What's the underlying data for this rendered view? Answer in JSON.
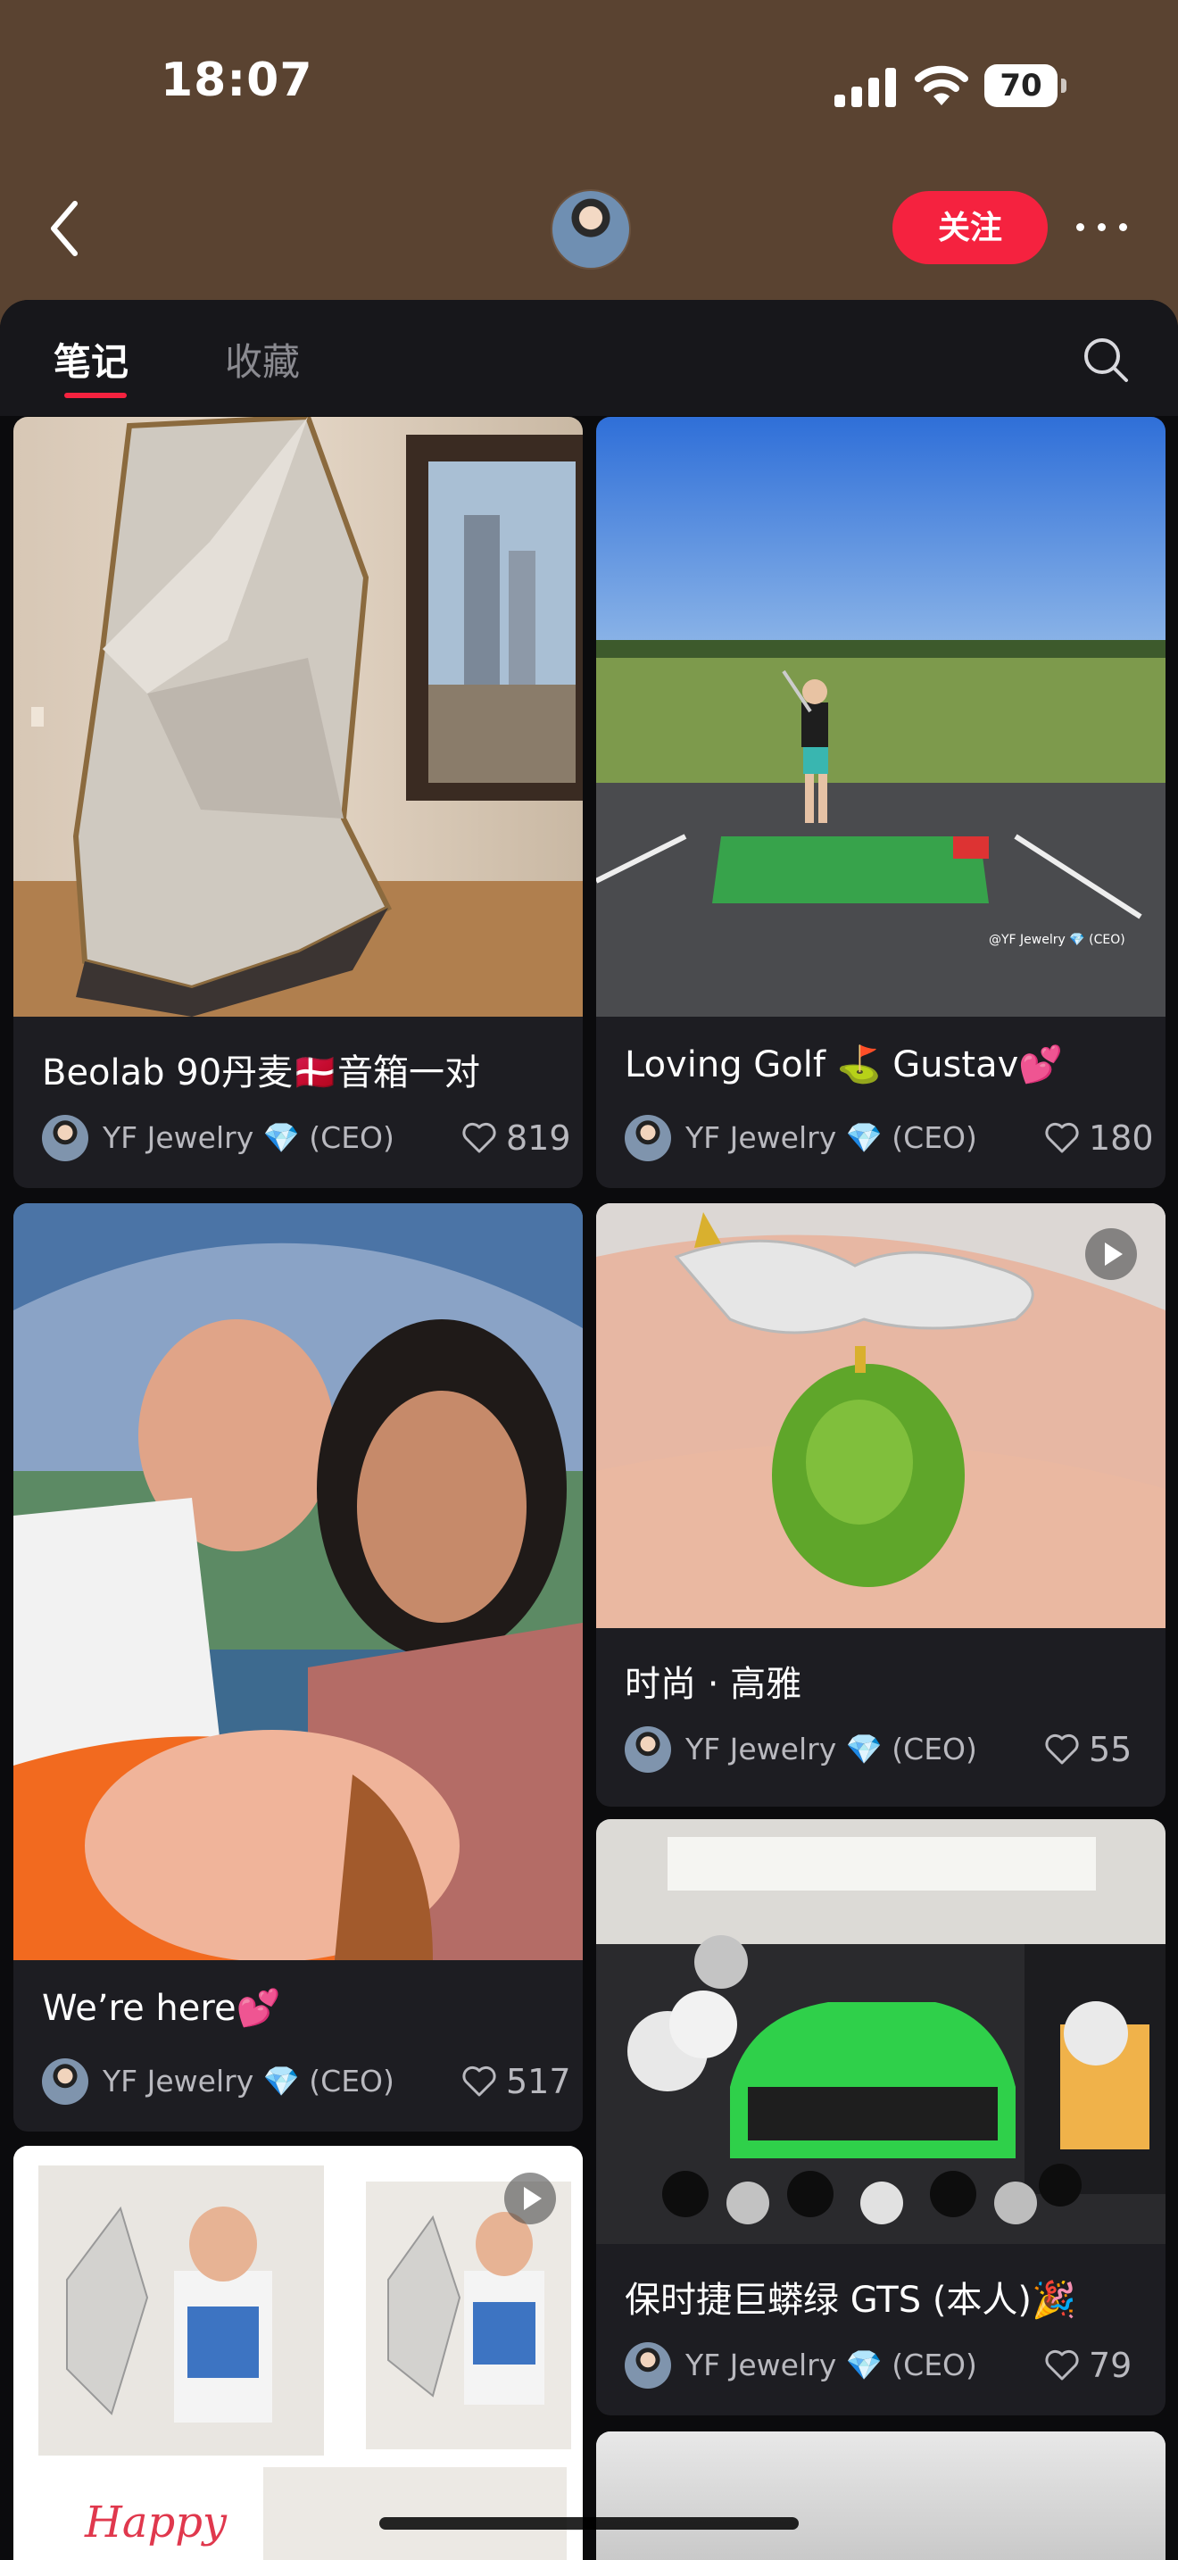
{
  "status_bar": {
    "time": "18:07",
    "battery": "70"
  },
  "header": {
    "follow_label": "关注"
  },
  "tabs": {
    "notes": "笔记",
    "collections": "收藏"
  },
  "cards": [
    {
      "title": "Beolab 90丹麦🇩🇰音箱一对",
      "author": "YF Jewelry 💎 (CEO)",
      "likes": "819"
    },
    {
      "title": "Loving Golf ⛳ Gustav💕",
      "author": "YF Jewelry 💎 (CEO)",
      "likes": "180",
      "watermark": "@YF Jewelry 💎 (CEO)"
    },
    {
      "title": "We’re here💕",
      "author": "YF Jewelry 💎 (CEO)",
      "likes": "517"
    },
    {
      "title": "时尚 · 高雅",
      "author": "YF Jewelry 💎 (CEO)",
      "likes": "55"
    },
    {
      "title": "保时捷巨蟒绿 GTS (本人)🎉",
      "author": "YF Jewelry 💎 (CEO)",
      "likes": "79"
    },
    {
      "title": "",
      "author": "",
      "likes": "",
      "image_text": "Happy"
    }
  ]
}
